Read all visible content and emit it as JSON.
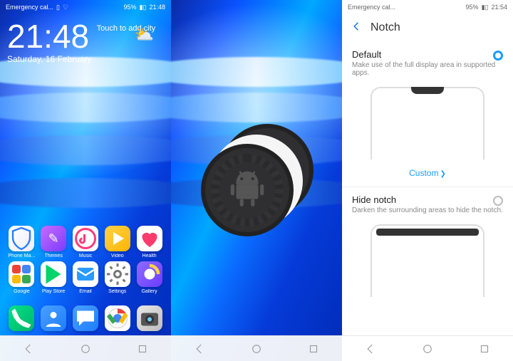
{
  "status": {
    "left_text": "Emergency cal...",
    "battery": "95%",
    "time1": "21:48",
    "time3": "21:54"
  },
  "home": {
    "clock": "21:48",
    "city_hint": "Touch to add city",
    "date": "Saturday, 16 February",
    "apps": [
      {
        "id": "phone-manager",
        "label": "Phone Ma..."
      },
      {
        "id": "themes",
        "label": "Themes"
      },
      {
        "id": "music",
        "label": "Music"
      },
      {
        "id": "video",
        "label": "Video"
      },
      {
        "id": "health",
        "label": "Health"
      },
      {
        "id": "google",
        "label": "Google"
      },
      {
        "id": "play-store",
        "label": "Play Store"
      },
      {
        "id": "email",
        "label": "Email"
      },
      {
        "id": "settings",
        "label": "Settings"
      },
      {
        "id": "gallery",
        "label": "Gallery"
      }
    ],
    "dock": [
      {
        "id": "dialer"
      },
      {
        "id": "contacts"
      },
      {
        "id": "messaging"
      },
      {
        "id": "chrome"
      },
      {
        "id": "camera"
      }
    ]
  },
  "settings": {
    "title": "Notch",
    "default": {
      "title": "Default",
      "desc": "Make use of the full display area in supported apps."
    },
    "custom_link": "Custom",
    "hide": {
      "title": "Hide notch",
      "desc": "Darken the surrounding areas to hide the notch."
    }
  }
}
